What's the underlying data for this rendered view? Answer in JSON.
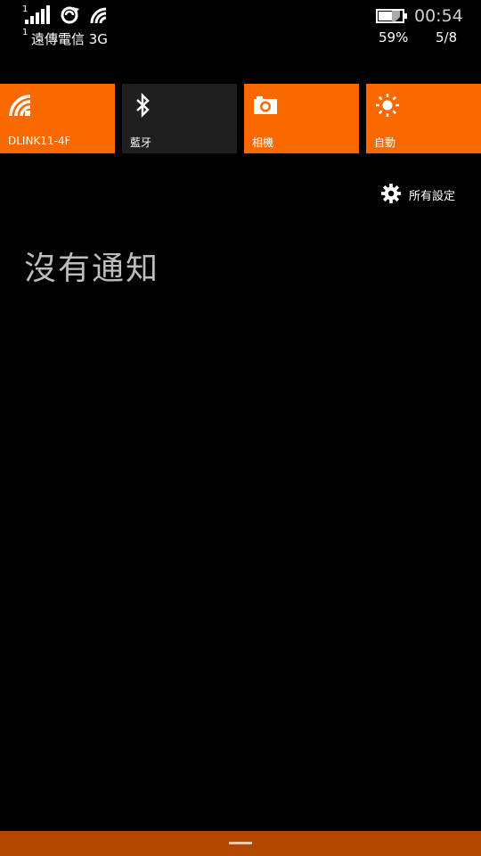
{
  "status_bar": {
    "sim_slot_signal": "1",
    "sim_slot_carrier": "1",
    "carrier": "遠傳電信 3G",
    "clock": "00:54",
    "battery_percent": "59%",
    "date": "5/8",
    "icons": [
      "signal-icon",
      "sync-icon",
      "wifi-icon",
      "battery-icon"
    ]
  },
  "quick_actions": {
    "tiles": [
      {
        "label": "DLINK11-4F",
        "icon": "wifi-icon",
        "state": "on"
      },
      {
        "label": "藍牙",
        "icon": "bluetooth-icon",
        "state": "off"
      },
      {
        "label": "相機",
        "icon": "camera-icon",
        "state": "on"
      },
      {
        "label": "自動",
        "icon": "brightness-icon",
        "state": "on"
      }
    ]
  },
  "all_settings": {
    "label": "所有設定",
    "icon": "gear-icon"
  },
  "notifications": {
    "empty_message": "沒有通知"
  },
  "colors": {
    "background": "#000000",
    "tile_on": "#fa6800",
    "tile_off": "#1f1f1f",
    "handle_bar": "#b34700",
    "text": "#ffffff",
    "muted_text": "#bdbdbd"
  }
}
